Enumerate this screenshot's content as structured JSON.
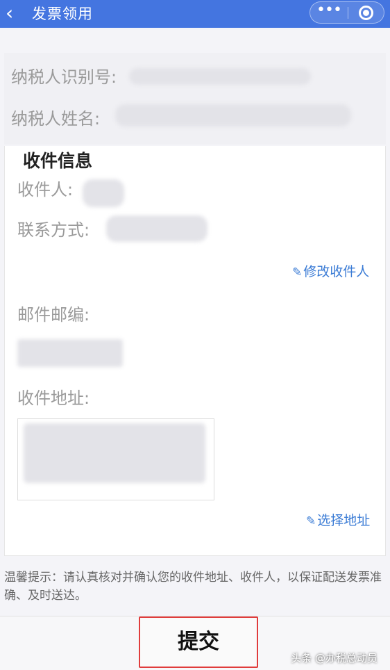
{
  "header": {
    "back_icon": "chevron-left-icon",
    "title": "发票领用",
    "more_icon": "more-dots-icon",
    "close_icon": "target-icon"
  },
  "taxpayer": {
    "id_label": "纳税人识别号:",
    "name_label": "纳税人姓名:"
  },
  "recipient": {
    "section_title": "收件信息",
    "recipient_label": "收件人:",
    "contact_label": "联系方式:",
    "edit_recipient_link": "修改收件人",
    "postcode_label": "邮件邮编:",
    "address_label": "收件地址:",
    "select_address_link": "选择地址"
  },
  "hint": {
    "text": "温馨提示：请认真核对并确认您的收件地址、收件人，以保证配送发票准确、及时送达。"
  },
  "footer": {
    "submit_label": "提交",
    "watermark": "头条 @办税总动员"
  },
  "colors": {
    "header_bg": "#4475e0",
    "link": "#3a7bd5",
    "highlight_border": "#e03c3c"
  }
}
